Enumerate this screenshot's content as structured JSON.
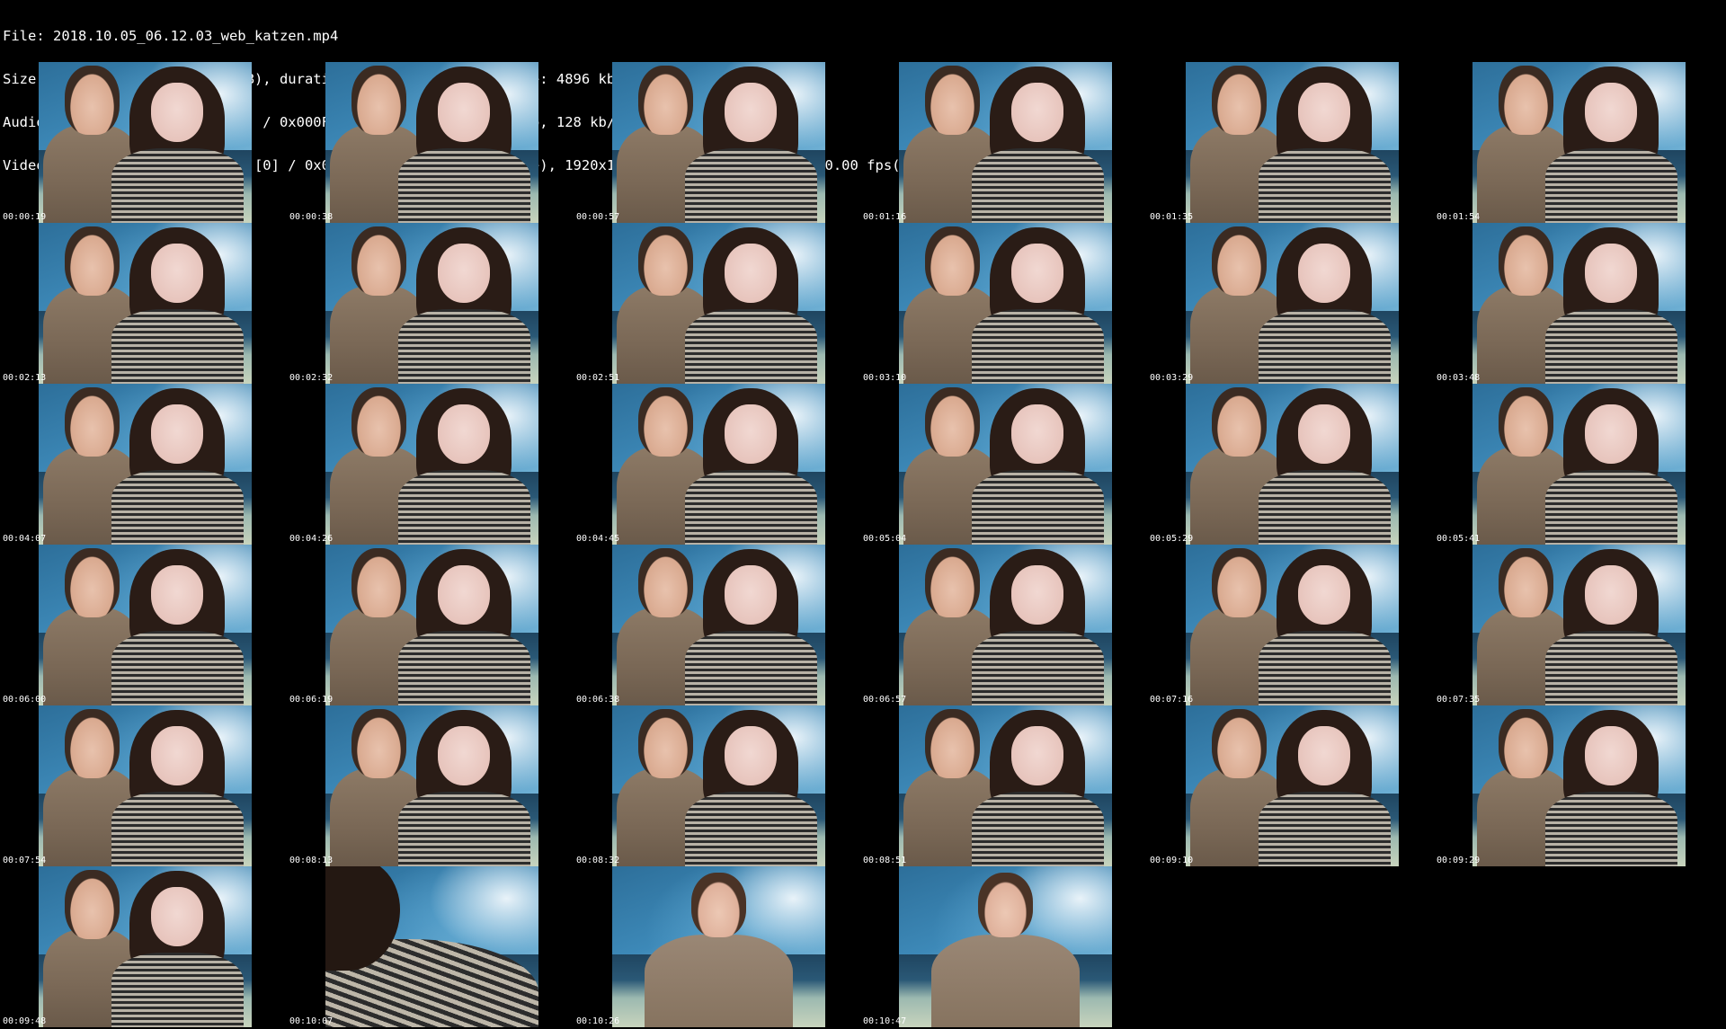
{
  "header": {
    "lines": [
      "File: 2018.10.05_06.12.03_web_katzen.mp4",
      "Size: 583193672 bytes (556 MiB), duration: 00:15:53, avg.bitrate: 4896 kb/s",
      "Audio: aac (LC) ([15][0][0][0] / 0x000F), 44100 Hz, stereo, fltp, 128 kb/s",
      "Video: h264 (High) ([27][0][0][0] / 0x001B), yuv420p(progressive), 1920x1080 [SAR 1:1 DAR 16:9], 10.00 fps(r)"
    ]
  },
  "thumbnails": [
    {
      "timestamp": "00:00:19",
      "scene": "couple"
    },
    {
      "timestamp": "00:00:38",
      "scene": "couple"
    },
    {
      "timestamp": "00:00:57",
      "scene": "couple"
    },
    {
      "timestamp": "00:01:16",
      "scene": "couple"
    },
    {
      "timestamp": "00:01:35",
      "scene": "couple"
    },
    {
      "timestamp": "00:01:54",
      "scene": "couple"
    },
    {
      "timestamp": "00:02:13",
      "scene": "couple"
    },
    {
      "timestamp": "00:02:32",
      "scene": "couple"
    },
    {
      "timestamp": "00:02:51",
      "scene": "couple"
    },
    {
      "timestamp": "00:03:10",
      "scene": "couple"
    },
    {
      "timestamp": "00:03:29",
      "scene": "couple"
    },
    {
      "timestamp": "00:03:48",
      "scene": "couple"
    },
    {
      "timestamp": "00:04:07",
      "scene": "couple"
    },
    {
      "timestamp": "00:04:26",
      "scene": "couple"
    },
    {
      "timestamp": "00:04:45",
      "scene": "couple"
    },
    {
      "timestamp": "00:05:04",
      "scene": "couple"
    },
    {
      "timestamp": "00:05:29",
      "scene": "couple"
    },
    {
      "timestamp": "00:05:41",
      "scene": "couple"
    },
    {
      "timestamp": "00:06:00",
      "scene": "couple"
    },
    {
      "timestamp": "00:06:19",
      "scene": "couple"
    },
    {
      "timestamp": "00:06:38",
      "scene": "couple"
    },
    {
      "timestamp": "00:06:57",
      "scene": "couple"
    },
    {
      "timestamp": "00:07:16",
      "scene": "couple"
    },
    {
      "timestamp": "00:07:35",
      "scene": "couple"
    },
    {
      "timestamp": "00:07:54",
      "scene": "couple"
    },
    {
      "timestamp": "00:08:13",
      "scene": "couple"
    },
    {
      "timestamp": "00:08:32",
      "scene": "couple"
    },
    {
      "timestamp": "00:08:51",
      "scene": "couple"
    },
    {
      "timestamp": "00:09:10",
      "scene": "couple"
    },
    {
      "timestamp": "00:09:29",
      "scene": "couple"
    },
    {
      "timestamp": "00:09:48",
      "scene": "couple"
    },
    {
      "timestamp": "00:10:07",
      "scene": "blur"
    },
    {
      "timestamp": "00:10:26",
      "scene": "solo"
    },
    {
      "timestamp": "00:10:47",
      "scene": "solo"
    }
  ]
}
